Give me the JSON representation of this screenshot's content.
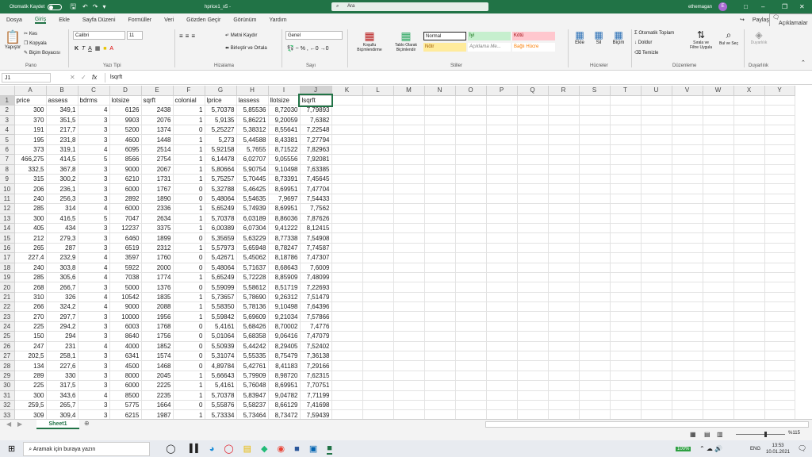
{
  "title_bar": {
    "autosave": "Otomatik Kaydet",
    "filename": "hprice1_x5 -",
    "search": "Ara",
    "user": "ethemagan",
    "user_initial": "E"
  },
  "menu": [
    "Dosya",
    "Giriş",
    "Ekle",
    "Sayfa Düzeni",
    "Formüller",
    "Veri",
    "Gözden Geçir",
    "Görünüm",
    "Yardım"
  ],
  "menu_right": {
    "share": "Paylaş",
    "comments": "Açıklamalar"
  },
  "ribbon": {
    "paste": "Yapıştır",
    "cut": "Kes",
    "copy": "Kopyala",
    "format_painter": "Biçim Boyacısı",
    "font_name": "Calibri",
    "font_size": "11",
    "wrap_text": "Metni Kaydır",
    "merge": "Birleştir ve Ortala",
    "number_format": "Genel",
    "cond_format": "Koşullu Biçimlendirme",
    "table_format": "Tablo Olarak Biçimlendir",
    "style_normal": "Normal",
    "style_iyi": "İyi",
    "style_kotu": "Kötü",
    "style_notr": "Nötr",
    "style_aciklama": "Açıklama Me...",
    "style_bagli": "Bağlı Hücre",
    "insert": "Ekle",
    "delete": "Sil",
    "format": "Biçim",
    "autosum": "Otomatik Toplam",
    "fill": "Doldur",
    "clear": "Temizle",
    "sort_filter": "Sırala ve Filtre Uygula",
    "find_select": "Bul ve Seç",
    "sensitivity": "Duyarlılık",
    "groups": [
      "Pano",
      "Yazı Tipi",
      "Hizalama",
      "Sayı",
      "Stiller",
      "Hücreler",
      "Düzenleme",
      "Duyarlılık"
    ]
  },
  "formula_bar": {
    "cell_ref": "J1",
    "fx": "fx",
    "content": "lsqrft"
  },
  "columns": [
    "A",
    "B",
    "C",
    "D",
    "E",
    "F",
    "G",
    "H",
    "I",
    "J",
    "K",
    "L",
    "M",
    "N",
    "O",
    "P",
    "Q",
    "R",
    "S",
    "T",
    "U",
    "V",
    "W",
    "X",
    "Y"
  ],
  "rows": [
    [
      "price",
      "assess",
      "bdrms",
      "lotsize",
      "sqrft",
      "colonial",
      "lprice",
      "lassess",
      "llotsize",
      "lsqrft"
    ],
    [
      "300",
      "349,1",
      "4",
      "6126",
      "2438",
      "1",
      "5,70378",
      "5,85536",
      "8,72030",
      "7,79893"
    ],
    [
      "370",
      "351,5",
      "3",
      "9903",
      "2076",
      "1",
      "5,9135",
      "5,86221",
      "9,20059",
      "7,6382"
    ],
    [
      "191",
      "217,7",
      "3",
      "5200",
      "1374",
      "0",
      "5,25227",
      "5,38312",
      "8,55641",
      "7,22548"
    ],
    [
      "195",
      "231,8",
      "3",
      "4600",
      "1448",
      "1",
      "5,273",
      "5,44588",
      "8,43381",
      "7,27794"
    ],
    [
      "373",
      "319,1",
      "4",
      "6095",
      "2514",
      "1",
      "5,92158",
      "5,7655",
      "8,71522",
      "7,82963"
    ],
    [
      "466,275",
      "414,5",
      "5",
      "8566",
      "2754",
      "1",
      "6,14478",
      "6,02707",
      "9,05556",
      "7,92081"
    ],
    [
      "332,5",
      "367,8",
      "3",
      "9000",
      "2067",
      "1",
      "5,80664",
      "5,90754",
      "9,10498",
      "7,63385"
    ],
    [
      "315",
      "300,2",
      "3",
      "6210",
      "1731",
      "1",
      "5,75257",
      "5,70445",
      "8,73391",
      "7,45645"
    ],
    [
      "206",
      "236,1",
      "3",
      "6000",
      "1767",
      "0",
      "5,32788",
      "5,46425",
      "8,69951",
      "7,47704"
    ],
    [
      "240",
      "256,3",
      "3",
      "2892",
      "1890",
      "0",
      "5,48064",
      "5,54635",
      "7,9697",
      "7,54433"
    ],
    [
      "285",
      "314",
      "4",
      "6000",
      "2336",
      "1",
      "5,65249",
      "5,74939",
      "8,69951",
      "7,7562"
    ],
    [
      "300",
      "416,5",
      "5",
      "7047",
      "2634",
      "1",
      "5,70378",
      "6,03189",
      "8,86036",
      "7,87626"
    ],
    [
      "405",
      "434",
      "3",
      "12237",
      "3375",
      "1",
      "6,00389",
      "6,07304",
      "9,41222",
      "8,12415"
    ],
    [
      "212",
      "279,3",
      "3",
      "6460",
      "1899",
      "0",
      "5,35659",
      "5,63229",
      "8,77338",
      "7,54908"
    ],
    [
      "265",
      "287",
      "3",
      "6519",
      "2312",
      "1",
      "5,57973",
      "5,65948",
      "8,78247",
      "7,74587"
    ],
    [
      "227,4",
      "232,9",
      "4",
      "3597",
      "1760",
      "0",
      "5,42671",
      "5,45062",
      "8,18786",
      "7,47307"
    ],
    [
      "240",
      "303,8",
      "4",
      "5922",
      "2000",
      "0",
      "5,48064",
      "5,71637",
      "8,68643",
      "7,6009"
    ],
    [
      "285",
      "305,6",
      "4",
      "7038",
      "1774",
      "1",
      "5,65249",
      "5,72228",
      "8,85909",
      "7,48099"
    ],
    [
      "268",
      "266,7",
      "3",
      "5000",
      "1376",
      "0",
      "5,59099",
      "5,58612",
      "8,51719",
      "7,22693"
    ],
    [
      "310",
      "326",
      "4",
      "10542",
      "1835",
      "1",
      "5,73657",
      "5,78690",
      "9,26312",
      "7,51479"
    ],
    [
      "266",
      "324,2",
      "4",
      "9000",
      "2088",
      "1",
      "5,58350",
      "5,78136",
      "9,10498",
      "7,64396"
    ],
    [
      "270",
      "297,7",
      "3",
      "10000",
      "1956",
      "1",
      "5,59842",
      "5,69609",
      "9,21034",
      "7,57866"
    ],
    [
      "225",
      "294,2",
      "3",
      "6003",
      "1768",
      "0",
      "5,4161",
      "5,68426",
      "8,70002",
      "7,4776"
    ],
    [
      "150",
      "294",
      "3",
      "8640",
      "1756",
      "0",
      "5,01064",
      "5,68358",
      "9,06416",
      "7,47079"
    ],
    [
      "247",
      "231",
      "4",
      "4000",
      "1852",
      "0",
      "5,50939",
      "5,44242",
      "8,29405",
      "7,52402"
    ],
    [
      "202,5",
      "258,1",
      "3",
      "6341",
      "1574",
      "0",
      "5,31074",
      "5,55335",
      "8,75479",
      "7,36138"
    ],
    [
      "134",
      "227,6",
      "3",
      "4500",
      "1468",
      "0",
      "4,89784",
      "5,42761",
      "8,41183",
      "7,29166"
    ],
    [
      "289",
      "330",
      "3",
      "8000",
      "2045",
      "1",
      "5,66643",
      "5,79909",
      "8,98720",
      "7,62315"
    ],
    [
      "225",
      "317,5",
      "3",
      "6000",
      "2225",
      "1",
      "5,4161",
      "5,76048",
      "8,69951",
      "7,70751"
    ],
    [
      "300",
      "343,6",
      "4",
      "8500",
      "2235",
      "1",
      "5,70378",
      "5,83947",
      "9,04782",
      "7,71199"
    ],
    [
      "259,5",
      "265,7",
      "3",
      "5775",
      "1664",
      "0",
      "5,55876",
      "5,58237",
      "8,66129",
      "7,41698"
    ],
    [
      "309",
      "309,4",
      "3",
      "6215",
      "1987",
      "1",
      "5,73334",
      "5,73464",
      "8,73472",
      "7,59439"
    ]
  ],
  "sheet_tab": "Sheet1",
  "status": {
    "zoom": "%115"
  },
  "taskbar": {
    "search": "Aramak için buraya yazın",
    "time": "13:53",
    "date": "10.01.2021",
    "lang": "ENG",
    "battery": "100%"
  }
}
